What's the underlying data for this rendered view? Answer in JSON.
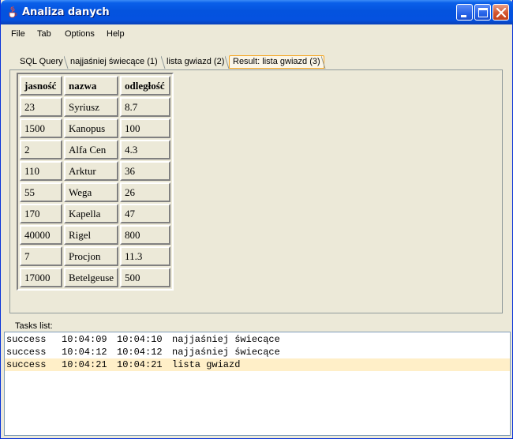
{
  "window": {
    "title": "Analiza danych"
  },
  "menu": [
    "File",
    "Tab",
    "Options",
    "Help"
  ],
  "tabs": [
    {
      "label": "SQL Query",
      "active": false
    },
    {
      "label": "najjaśniej świecące (1)",
      "active": false
    },
    {
      "label": "lista gwiazd (2)",
      "active": false
    },
    {
      "label": "Result: lista gwiazd (3)",
      "active": true
    }
  ],
  "table": {
    "headers": [
      "jasność",
      "nazwa",
      "odległość"
    ],
    "rows": [
      [
        "23",
        "Syriusz",
        "8.7"
      ],
      [
        "1500",
        "Kanopus",
        "100"
      ],
      [
        "2",
        "Alfa Cen",
        "4.3"
      ],
      [
        "110",
        "Arktur",
        "36"
      ],
      [
        "55",
        "Wega",
        "26"
      ],
      [
        "170",
        "Kapella",
        "47"
      ],
      [
        "40000",
        "Rigel",
        "800"
      ],
      [
        "7",
        "Procjon",
        "11.3"
      ],
      [
        "17000",
        "Betelgeuse",
        "500"
      ]
    ]
  },
  "tasks": {
    "label": "Tasks list:",
    "rows": [
      {
        "status": "success",
        "start": "10:04:09",
        "end": "10:04:10",
        "name": "najjaśniej świecące",
        "selected": false
      },
      {
        "status": "success",
        "start": "10:04:12",
        "end": "10:04:12",
        "name": "najjaśniej świecące",
        "selected": false
      },
      {
        "status": "success",
        "start": "10:04:21",
        "end": "10:04:21",
        "name": "lista gwiazd",
        "selected": true
      }
    ]
  },
  "colors": {
    "titlebar": "#0453DE",
    "active_tab_border": "#F5A623",
    "selected_row": "#FFEFC8"
  },
  "icons": {
    "app": "java-cup-icon",
    "minimize": "minimize-icon",
    "maximize": "maximize-icon",
    "close": "close-icon"
  }
}
